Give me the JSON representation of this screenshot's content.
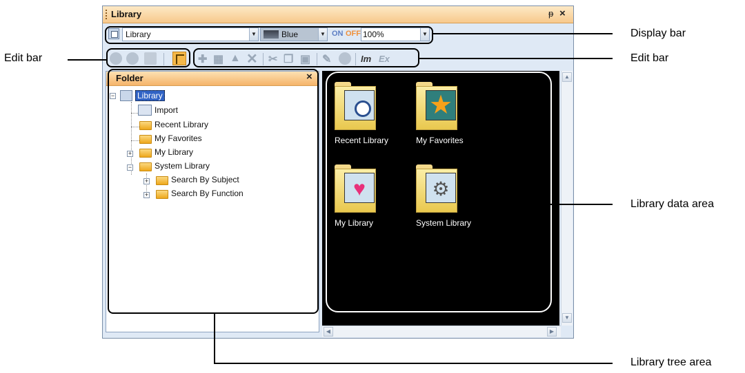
{
  "window": {
    "title": "Library"
  },
  "display_bar": {
    "library_combo": "Library",
    "color_combo": "Blue",
    "on_label": "ON",
    "off_label": "OFF",
    "zoom_combo": "100%"
  },
  "folder_panel": {
    "title": "Folder",
    "tree": {
      "root": "Library",
      "import": "Import",
      "recent": "Recent Library",
      "favorites": "My Favorites",
      "my_library": "My Library",
      "system_library": "System Library",
      "by_subject": "Search By Subject",
      "by_function": "Search By Function"
    }
  },
  "data_area": {
    "tiles": [
      "Recent Library",
      "My Favorites",
      "My Library",
      "System Library"
    ]
  },
  "annotations": {
    "display_bar": "Display bar",
    "edit_bar_left": "Edit bar",
    "edit_bar_right": "Edit bar",
    "library_data_area": "Library data area",
    "library_tree_area": "Library tree area"
  },
  "colors": {
    "title_orange": "#f7c98c",
    "data_area_bg": "#000000",
    "on_color": "#5c7ec4",
    "off_color": "#f0903a"
  },
  "icons": [
    "pin-icon",
    "close-icon",
    "library-icon",
    "back-icon",
    "forward-icon",
    "up-icon",
    "tree-view-icon",
    "new-icon",
    "copy-icon",
    "export-icon",
    "delete-icon",
    "cut-icon",
    "paste-icon",
    "edit-icon",
    "info-icon",
    "import-icon",
    "export-ex-icon",
    "folder-icon",
    "clock-icon",
    "star-icon",
    "heart-icon",
    "gear-icon"
  ]
}
